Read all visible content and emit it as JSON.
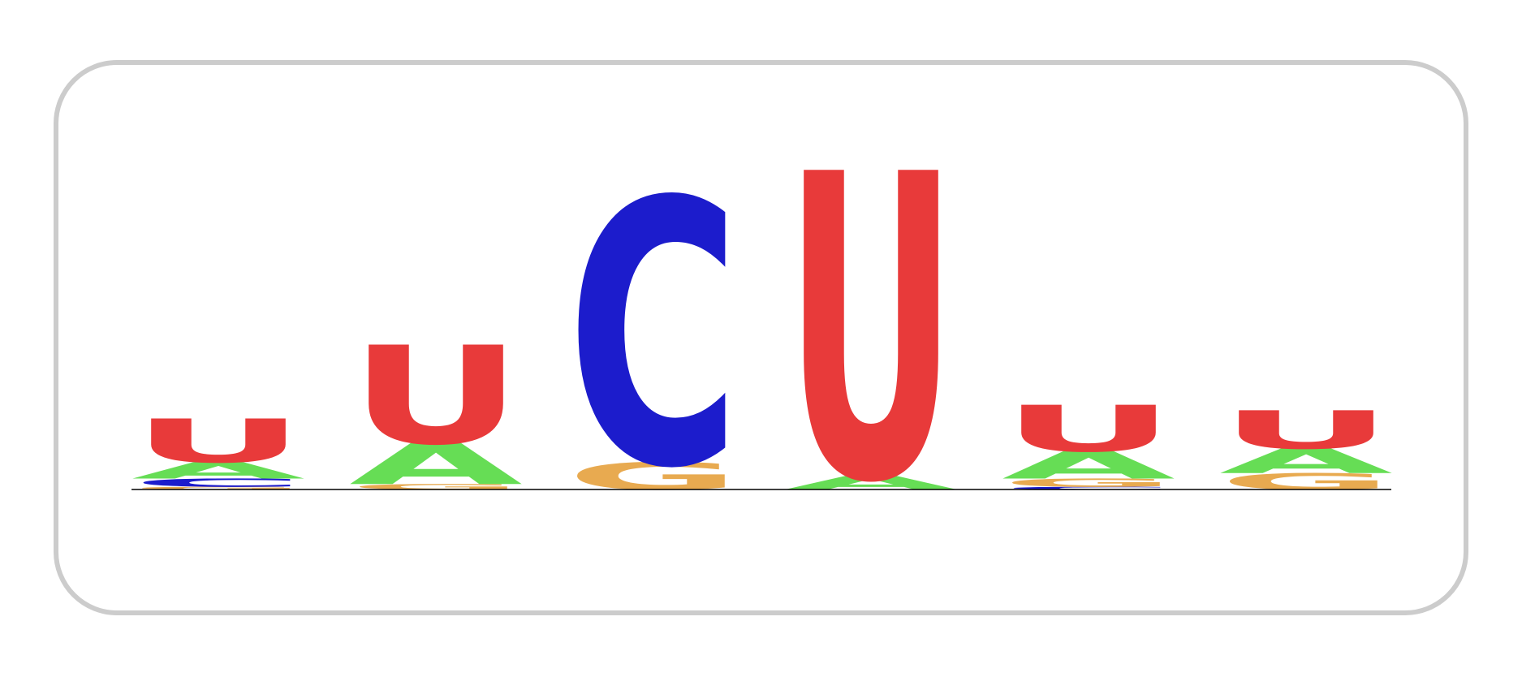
{
  "chart_data": {
    "type": "sequence-logo",
    "alphabet": "RNA",
    "colors": {
      "A": "#66dd55",
      "C": "#1c1ccc",
      "G": "#e8aa50",
      "U": "#e83a3a"
    },
    "positions": [
      {
        "index": 1,
        "stack": [
          {
            "letter": "G",
            "bits": 0.01
          },
          {
            "letter": "C",
            "bits": 0.03
          },
          {
            "letter": "A",
            "bits": 0.06
          },
          {
            "letter": "U",
            "bits": 0.16
          }
        ]
      },
      {
        "index": 2,
        "stack": [
          {
            "letter": "G",
            "bits": 0.02
          },
          {
            "letter": "A",
            "bits": 0.15
          },
          {
            "letter": "U",
            "bits": 0.36
          }
        ]
      },
      {
        "index": 3,
        "stack": [
          {
            "letter": "G",
            "bits": 0.1
          },
          {
            "letter": "C",
            "bits": 0.97
          }
        ]
      },
      {
        "index": 4,
        "stack": [
          {
            "letter": "A",
            "bits": 0.05
          },
          {
            "letter": "U",
            "bits": 1.12
          }
        ]
      },
      {
        "index": 5,
        "stack": [
          {
            "letter": "C",
            "bits": 0.01
          },
          {
            "letter": "G",
            "bits": 0.03
          },
          {
            "letter": "A",
            "bits": 0.1
          },
          {
            "letter": "U",
            "bits": 0.17
          }
        ]
      },
      {
        "index": 6,
        "stack": [
          {
            "letter": "G",
            "bits": 0.06
          },
          {
            "letter": "A",
            "bits": 0.09
          },
          {
            "letter": "U",
            "bits": 0.14
          }
        ]
      }
    ]
  }
}
